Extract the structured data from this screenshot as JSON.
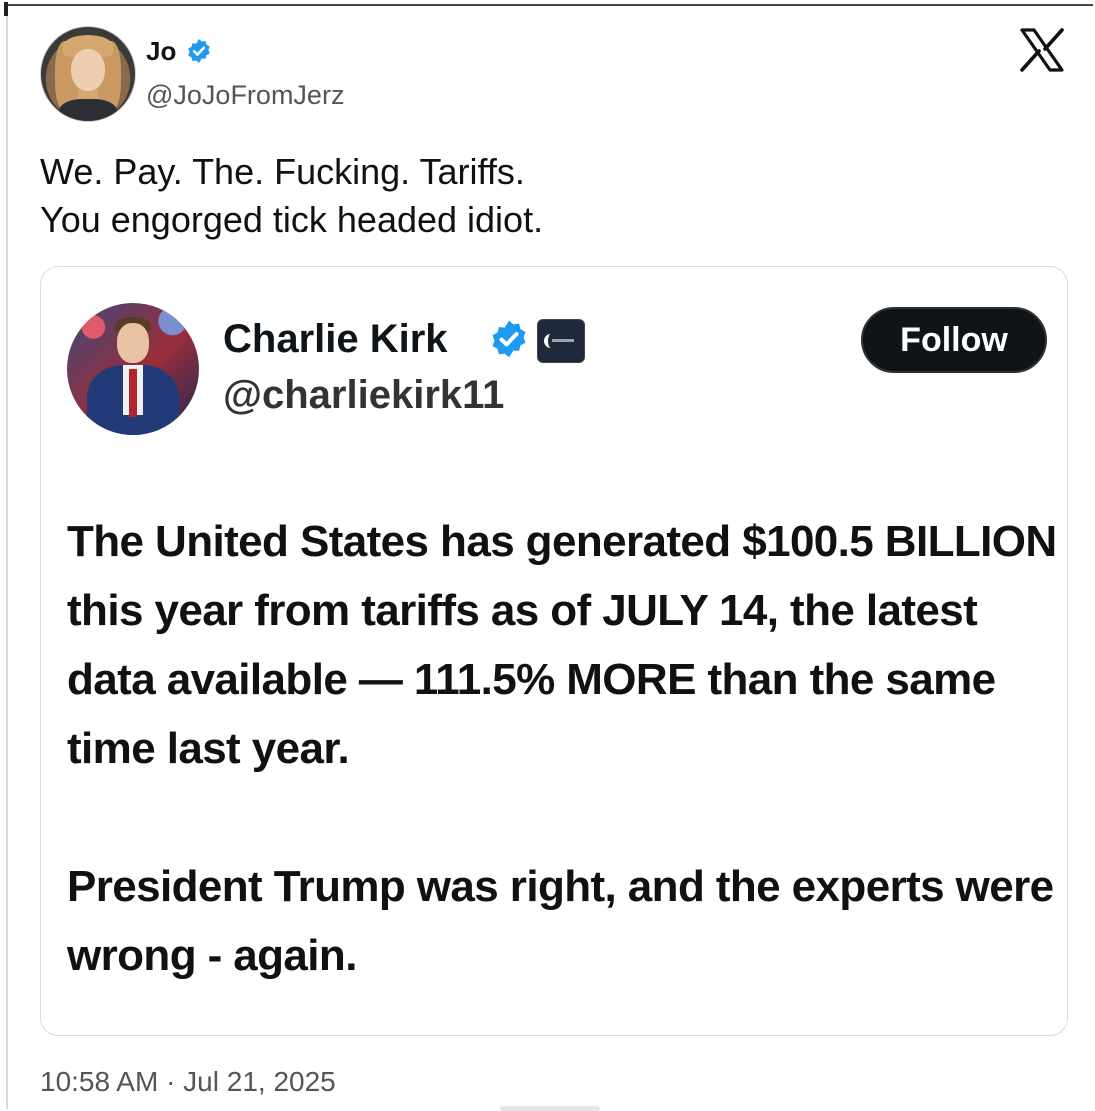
{
  "author": {
    "name": "Jo",
    "handle": "@JoJoFromJerz",
    "verified": true
  },
  "tweet": {
    "lines": [
      "We. Pay. The. Fucking. Tariffs.",
      "You engorged tick headed idiot."
    ],
    "timestamp": "10:58 AM · Jul 21, 2025"
  },
  "quoted": {
    "name": "Charlie Kirk",
    "handle": "@charliekirk11",
    "verified": true,
    "follow_label": "Follow",
    "paragraph1": "The United States has generated $100.5 BILLION this year from tariffs as of JULY 14, the latest data available — 111.5% MORE than the same time last year.",
    "paragraph2": "President Trump was right, and the experts were wrong - again."
  },
  "icons": {
    "brand": "x-logo-icon",
    "verified": "verified-badge-icon",
    "affiliation": "affiliation-badge-icon"
  },
  "colors": {
    "verified_blue": "#1d9bf0",
    "follow_bg": "#0f1419",
    "text_secondary": "#555555",
    "card_border": "#d8dde2"
  }
}
